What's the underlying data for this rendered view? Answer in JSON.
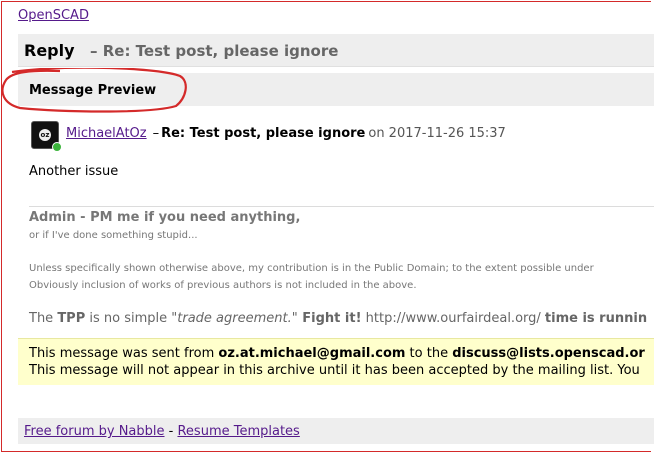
{
  "header": {
    "site_link": "OpenSCAD"
  },
  "reply_bar": {
    "label": "Reply",
    "subject": "– Re: Test post, please ignore"
  },
  "preview": {
    "title": "Message Preview"
  },
  "post": {
    "author": "MichaelAtOz",
    "dash": "–",
    "subject": "Re: Test post, please ignore",
    "meta": "on 2017-11-26 15:37",
    "body": "Another issue"
  },
  "signature": {
    "admin_line": "Admin - PM me if you need anything,",
    "admin_sub": "or if I've done something stupid...",
    "domain_line": "Unless specifically shown otherwise above, my contribution is in the Public Domain; to the extent possible under",
    "inclusion_line": "Obviously inclusion of works of previous authors is not included in the above.",
    "tpp_pre": "The ",
    "tpp_bold": "TPP",
    "tpp_mid": " is no simple ",
    "tpp_italic": "\"trade agreement.\"",
    "tpp_fight": " Fight it!",
    "tpp_url": " http://www.ourfairdeal.org/ ",
    "tpp_end": "time is runnin"
  },
  "notice": {
    "line1_pre": "This message was sent from ",
    "line1_from": "oz.at.michael@gmail.com",
    "line1_mid": " to the ",
    "line1_to": "discuss@lists.openscad.or",
    "line2": "This message will not appear in this archive until it has been accepted by the mailing list. You"
  },
  "footer": {
    "link1": "Free forum by Nabble",
    "sep": " - ",
    "link2": "Resume Templates"
  },
  "colors": {
    "annotation": "#d42a2a",
    "link": "#551a8b",
    "notice_bg": "#ffffcc",
    "bar_bg": "#eeeeee",
    "online": "#3bb43b"
  }
}
